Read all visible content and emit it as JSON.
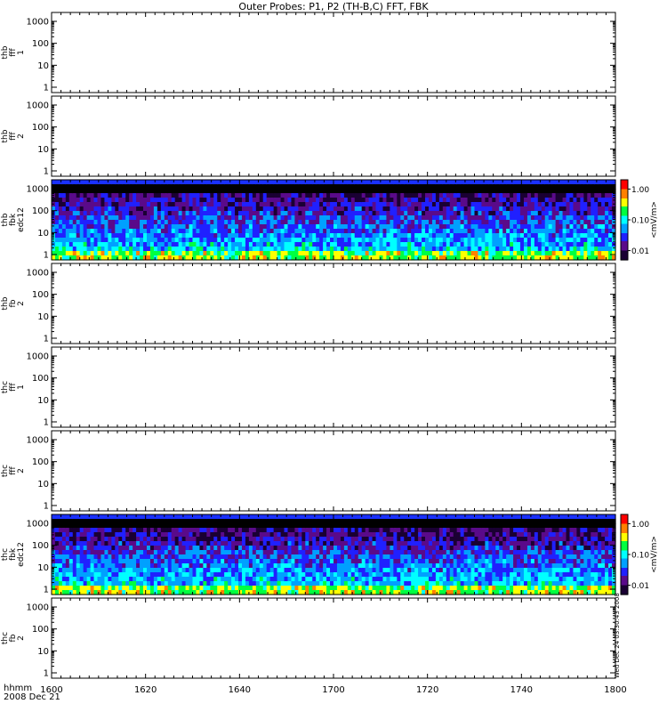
{
  "chart_data": {
    "type": "heatmap",
    "title": "Outer Probes: P1, P2 (TH-B,C) FFT, FBK",
    "x_axis": {
      "label_line1": "hhmm",
      "label_line2": "2008 Dec 21",
      "range": [
        1600,
        1800
      ],
      "ticks": [
        "1600",
        "1620",
        "1640",
        "1700",
        "1720",
        "1740",
        "1800"
      ]
    },
    "y_axis": {
      "scale": "log",
      "range": [
        1,
        1000
      ],
      "ticks": [
        "1",
        "10",
        "100",
        "1000"
      ]
    },
    "panels": [
      {
        "label_lines": [
          "thb",
          "fff",
          "1"
        ],
        "has_data": false
      },
      {
        "label_lines": [
          "thb",
          "fff",
          "2"
        ],
        "has_data": false
      },
      {
        "label_lines": [
          "thb",
          "fbk",
          "edc12"
        ],
        "has_data": true,
        "colorbar": {
          "label": "<mV/m>",
          "ticks": [
            "1.00",
            "0.10",
            "0.01"
          ],
          "range": [
            0.005,
            2.0
          ],
          "scale": "log"
        }
      },
      {
        "label_lines": [
          "thb",
          "fb",
          "2"
        ],
        "has_data": false
      },
      {
        "label_lines": [
          "thc",
          "fff",
          "1"
        ],
        "has_data": false
      },
      {
        "label_lines": [
          "thc",
          "fff",
          "2"
        ],
        "has_data": false
      },
      {
        "label_lines": [
          "thc",
          "fbk",
          "edc12"
        ],
        "has_data": true,
        "colorbar": {
          "label": "<mV/m>",
          "ticks": [
            "1.00",
            "0.10",
            "0.01"
          ],
          "range": [
            0.005,
            2.0
          ],
          "scale": "log"
        }
      },
      {
        "label_lines": [
          "thc",
          "fb",
          "2"
        ],
        "has_data": false
      }
    ],
    "side_note": "Wed Dec 24 03:30:43 2008",
    "colors": {
      "scale": [
        "#1a0033",
        "#5a0a8a",
        "#2020ff",
        "#00a0ff",
        "#00ffff",
        "#00ff40",
        "#ffff00",
        "#ff8000",
        "#ff0000"
      ],
      "saturated_band": "#000000",
      "frame": "#000000"
    }
  }
}
